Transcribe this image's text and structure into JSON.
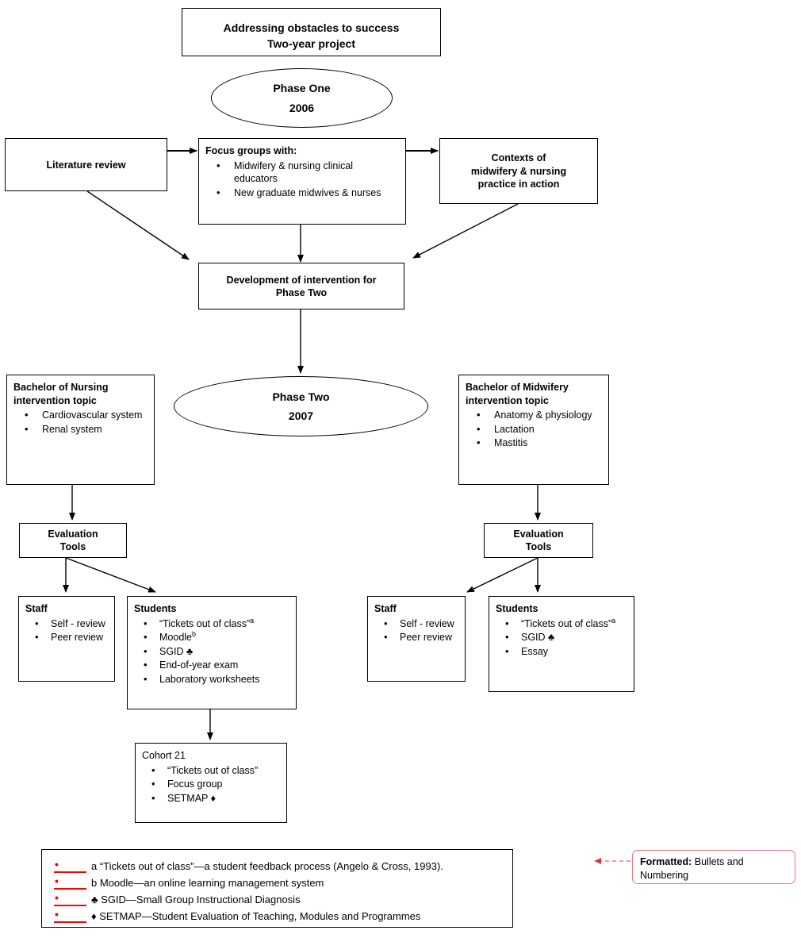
{
  "title_box": {
    "line1": "Addressing obstacles to success",
    "line2": "Two-year project"
  },
  "phase_one": {
    "name": "Phase One",
    "year": "2006"
  },
  "phase_two": {
    "name": "Phase Two",
    "year": "2007"
  },
  "literature_review": {
    "label": "Literature review"
  },
  "focus_groups": {
    "heading": "Focus groups with:",
    "items": [
      "Midwifery & nursing clinical educators",
      "New graduate midwives & nurses"
    ]
  },
  "contexts": {
    "line1": "Contexts of",
    "line2": "midwifery & nursing",
    "line3": "practice in action"
  },
  "development": {
    "line1": "Development of intervention for",
    "line2": "Phase Two"
  },
  "nursing_topic": {
    "heading_line1": "Bachelor of Nursing",
    "heading_line2": "intervention topic",
    "items": [
      "Cardiovascular system",
      "Renal system"
    ]
  },
  "midwifery_topic": {
    "heading_line1": "Bachelor of Midwifery",
    "heading_line2": "intervention topic",
    "items": [
      "Anatomy & physiology",
      "Lactation",
      "Mastitis"
    ]
  },
  "evaluation_tools_left": {
    "line1": "Evaluation",
    "line2": "Tools"
  },
  "evaluation_tools_right": {
    "line1": "Evaluation",
    "line2": "Tools"
  },
  "staff_left": {
    "heading": "Staff",
    "items": [
      "Self - review",
      "Peer review"
    ]
  },
  "students_left": {
    "heading": "Students",
    "items": [
      {
        "text": "“Tickets out of class”",
        "sup": "a"
      },
      {
        "text": "Moodle",
        "sup": "b"
      },
      {
        "text": "SGID ♣",
        "sup": ""
      },
      {
        "text": "End-of-year exam",
        "sup": ""
      },
      {
        "text": "Laboratory worksheets",
        "sup": ""
      }
    ]
  },
  "staff_right": {
    "heading": "Staff",
    "items": [
      "Self - review",
      "Peer review"
    ]
  },
  "students_right": {
    "heading": "Students",
    "items": [
      {
        "text": "“Tickets out of class”",
        "sup": "a"
      },
      {
        "text": "SGID ♣",
        "sup": ""
      },
      {
        "text": "Essay",
        "sup": ""
      }
    ]
  },
  "cohort": {
    "heading": "Cohort 21",
    "items": [
      "“Tickets out of class”",
      "Focus group",
      "SETMAP ♦"
    ]
  },
  "legend": {
    "items": [
      "a “Tickets out of class”—a student feedback process (Angelo & Cross, 1993).",
      "b Moodle—an online learning management system",
      "♣ SGID—Small Group Instructional Diagnosis",
      "♦ SETMAP—Student Evaluation of Teaching, Modules and Programmes"
    ]
  },
  "comment_balloon": {
    "label": "Formatted:",
    "text": " Bullets and Numbering"
  },
  "colors": {
    "stroke": "#000000",
    "tracked_change": "#ff0000",
    "balloon_border": "#f4737d"
  }
}
